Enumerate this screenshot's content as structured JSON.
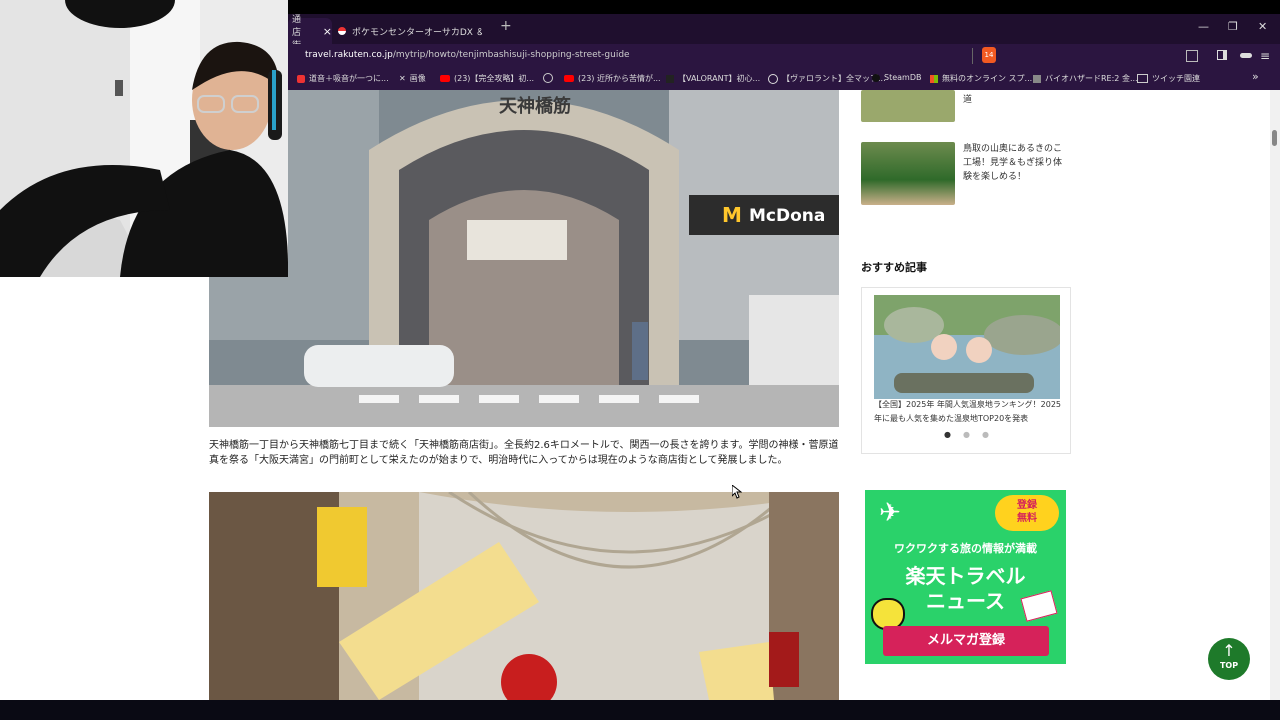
{
  "browser": {
    "tabs": [
      {
        "label": "通店街",
        "active": true
      },
      {
        "label": "ポケモンセンターオーサカDX ＆ ポケモンカ",
        "active": false
      }
    ],
    "close_glyph": "×",
    "new_tab_glyph": "+",
    "url_host": "travel.rakuten.co.jp",
    "url_path": "/mytrip/howto/tenjimbashisuji-shopping-street-guide",
    "brave_badge": "14",
    "window_controls": [
      "—",
      "❐",
      "✕"
    ],
    "bookmarks": [
      "道音＋吸音が一つに...",
      "画像",
      "(23)【完全攻略】初...",
      "",
      "(23) 近所から苦情が...",
      "【VALORANT】初心...",
      "【ヴァロラント】全マップ...",
      "SteamDB",
      "無料のオンライン スプ...",
      "バイオハザードRE:2 金...",
      "ツイッチ園連"
    ],
    "bookmarks_more": "»"
  },
  "article": {
    "photo1_sign": "天神橋筋",
    "photo1_store": "McDona",
    "caption": "天神橋筋一丁目から天神橋筋七丁目まで続く「天神橋筋商店街」。全長約2.6キロメートルで、関西一の長さを誇ります。学問の神様・菅原道真を祭る「大阪天満宮」の門前町として栄えたのが始まりで、明治時代に入ってからは現在のような商店街として発展しました。"
  },
  "sidebar": {
    "related": [
      {
        "text": "道"
      },
      {
        "text": "鳥取の山奥にあるきのこ工場！見学＆もぎ採り体験を楽しめる！"
      }
    ],
    "recommend_title": "おすすめ記事",
    "carousel_text": "【全国】2025年 年間人気温泉地ランキング！2025年に最も人気を集めた温泉地TOP20を発表",
    "banner": {
      "badge": "登録\n無料",
      "line1": "ワクワクする旅の情報が満載",
      "line2": "楽天トラベル",
      "line3": "ニュース",
      "cta": "メルマガ登録"
    },
    "top_button": "TOP",
    "top_arrow": "↑"
  },
  "colors": {
    "tab_bg": "#1f0f2e",
    "toolbar_bg": "#2b1540",
    "banner_green": "#2ad26a",
    "cta_pink": "#d6225a",
    "top_green": "#1e7a2a"
  }
}
